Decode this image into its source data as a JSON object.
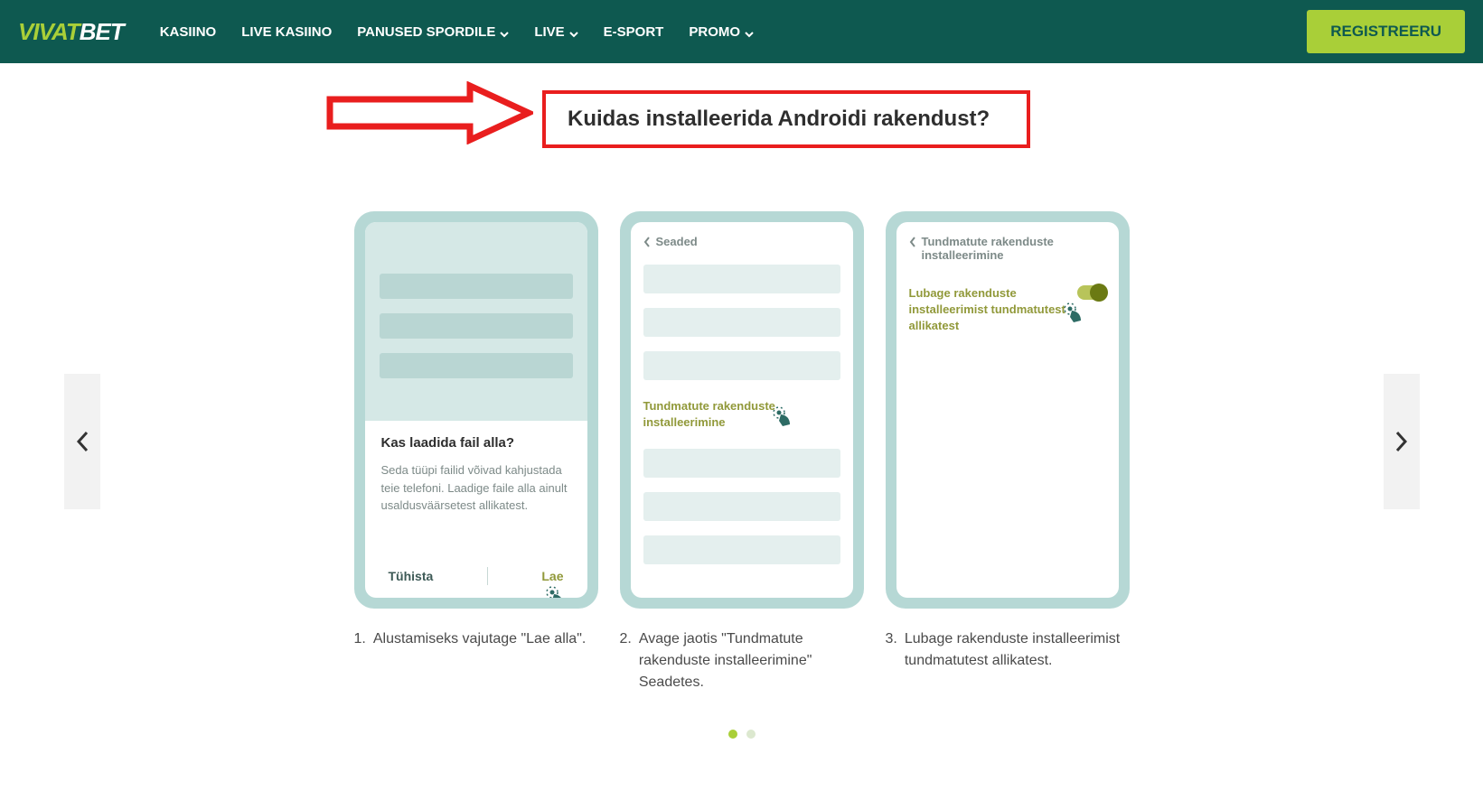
{
  "header": {
    "logo": {
      "part1": "VIVAT",
      "part2": "BET"
    },
    "nav": [
      {
        "label": "KASIINO",
        "dropdown": false
      },
      {
        "label": "LIVE KASIINO",
        "dropdown": false
      },
      {
        "label": "PANUSED SPORDILE",
        "dropdown": true
      },
      {
        "label": "LIVE",
        "dropdown": true
      },
      {
        "label": "E-SPORT",
        "dropdown": false
      },
      {
        "label": "PROMO",
        "dropdown": true
      }
    ],
    "register": "REGISTREERU"
  },
  "title": "Kuidas installeerida Androidi rakendust?",
  "phone1": {
    "dialog_title": "Kas laadida fail alla?",
    "dialog_body": "Seda tüüpi failid võivad kahjustada teie telefoni. Laadige faile alla ainult usaldusväärsetest allikatest.",
    "cancel": "Tühista",
    "load": "Lae"
  },
  "phone2": {
    "header": "Seaded",
    "highlight": "Tundmatute rakenduste installeerimine"
  },
  "phone3": {
    "header": "Tundmatute rakenduste installeerimine",
    "text": "Lubage rakenduste installeerimist tundmatutest allikatest"
  },
  "captions": [
    {
      "num": "1.",
      "text": "Alustamiseks vajutage \"Lae alla\"."
    },
    {
      "num": "2.",
      "text": "Avage jaotis \"Tundmatute rakenduste installeerimine\" Seadetes."
    },
    {
      "num": "3.",
      "text": "Lubage rakenduste installeerimist tundmatutest allikatest."
    }
  ]
}
